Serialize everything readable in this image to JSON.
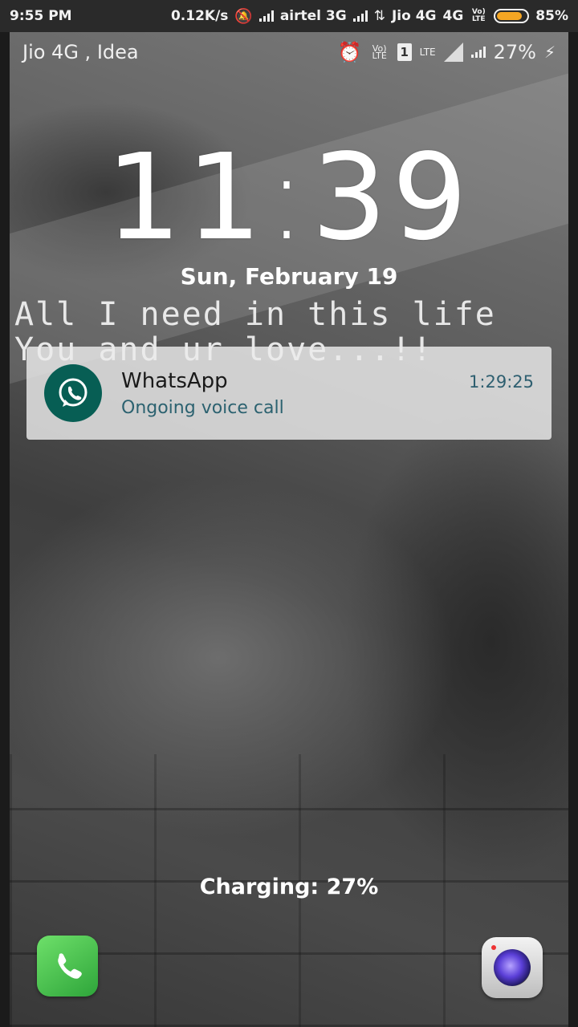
{
  "outer_status": {
    "time": "9:55 PM",
    "net_speed": "0.12K/s",
    "carrier1": "airtel 3G",
    "carrier2": "Jio 4G",
    "net_type": "4G",
    "volte": "Vo) LTE",
    "battery": "85%",
    "battery_level": 0.85,
    "battery_color": "#f5a623"
  },
  "lock_status": {
    "carrier": "Jio 4G , Idea",
    "volte": "Vo) LTE",
    "sim": "1",
    "lte": "LTE",
    "battery": "27%"
  },
  "clock": {
    "hours": "11",
    "minutes": "39"
  },
  "date": "Sun, February 19",
  "quote": {
    "line1": "All I need in this life",
    "line2": "You and ur love...!!"
  },
  "notification": {
    "app": "WhatsApp",
    "text": "Ongoing voice call",
    "time": "1:29:25",
    "icon": "whatsapp-icon"
  },
  "charging": "Charging: 27%",
  "shortcuts": {
    "left": "phone-icon",
    "right": "camera-icon"
  }
}
